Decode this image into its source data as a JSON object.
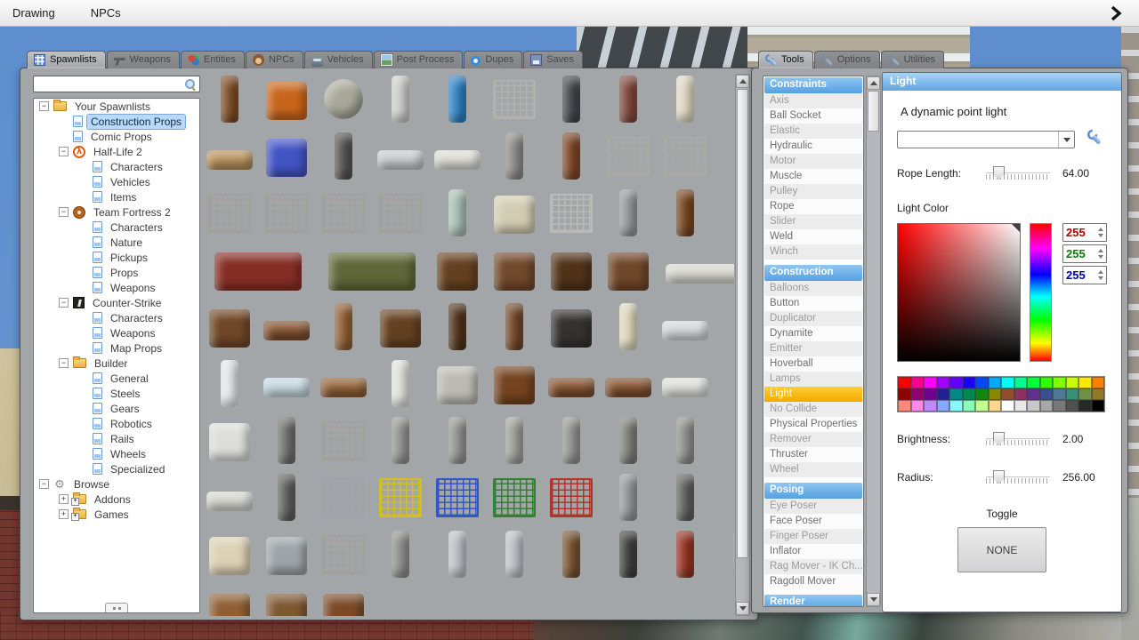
{
  "menubar": {
    "items": [
      "Drawing",
      "NPCs"
    ]
  },
  "spawnmenu": {
    "tabs": [
      {
        "id": "spawnlists",
        "label": "Spawnlists",
        "active": true
      },
      {
        "id": "weapons",
        "label": "Weapons"
      },
      {
        "id": "entities",
        "label": "Entities"
      },
      {
        "id": "npcs",
        "label": "NPCs"
      },
      {
        "id": "vehicles",
        "label": "Vehicles"
      },
      {
        "id": "postprocess",
        "label": "Post Process"
      },
      {
        "id": "dupes",
        "label": "Dupes"
      },
      {
        "id": "saves",
        "label": "Saves"
      }
    ],
    "search": {
      "value": "",
      "icon": "search-icon"
    },
    "tree": {
      "items": [
        {
          "d": 0,
          "e": "-",
          "i": "folder",
          "t": "Your Spawnlists"
        },
        {
          "d": 1,
          "i": "page",
          "t": "Construction Props",
          "sel": true
        },
        {
          "d": 1,
          "i": "page",
          "t": "Comic Props"
        },
        {
          "d": 1,
          "e": "-",
          "i": "hl2",
          "t": "Half-Life 2"
        },
        {
          "d": 2,
          "i": "page",
          "t": "Characters"
        },
        {
          "d": 2,
          "i": "page",
          "t": "Vehicles"
        },
        {
          "d": 2,
          "i": "page",
          "t": "Items"
        },
        {
          "d": 1,
          "e": "-",
          "i": "tf2",
          "t": "Team Fortress 2"
        },
        {
          "d": 2,
          "i": "page",
          "t": "Characters"
        },
        {
          "d": 2,
          "i": "page",
          "t": "Nature"
        },
        {
          "d": 2,
          "i": "page",
          "t": "Pickups"
        },
        {
          "d": 2,
          "i": "page",
          "t": "Props"
        },
        {
          "d": 2,
          "i": "page",
          "t": "Weapons"
        },
        {
          "d": 1,
          "e": "-",
          "i": "cs",
          "t": "Counter-Strike"
        },
        {
          "d": 2,
          "i": "page",
          "t": "Characters"
        },
        {
          "d": 2,
          "i": "page",
          "t": "Weapons"
        },
        {
          "d": 2,
          "i": "page",
          "t": "Map Props"
        },
        {
          "d": 1,
          "e": "-",
          "i": "folder",
          "t": "Builder"
        },
        {
          "d": 2,
          "i": "page",
          "t": "General"
        },
        {
          "d": 2,
          "i": "page",
          "t": "Steels"
        },
        {
          "d": 2,
          "i": "page",
          "t": "Gears"
        },
        {
          "d": 2,
          "i": "page",
          "t": "Robotics"
        },
        {
          "d": 2,
          "i": "page",
          "t": "Rails"
        },
        {
          "d": 2,
          "i": "page",
          "t": "Wheels"
        },
        {
          "d": 2,
          "i": "page",
          "t": "Specialized"
        },
        {
          "d": 0,
          "e": "-",
          "i": "gear",
          "t": "Browse"
        },
        {
          "d": 1,
          "e": "+",
          "i": "folder-add",
          "t": "Addons"
        },
        {
          "d": 1,
          "e": "+",
          "i": "folder-add",
          "t": "Games"
        }
      ]
    },
    "props": {
      "rows": [
        [
          {
            "n": "bar-stool",
            "c": "#7b4a26",
            "s": "tall"
          },
          {
            "n": "cable-spools",
            "c": "#c8651c",
            "s": "box"
          },
          {
            "n": "pulley-wheel",
            "c": "#a8a89a",
            "s": "round"
          },
          {
            "n": "metal-panel",
            "c": "#cdcdc8",
            "s": "tall"
          },
          {
            "n": "blue-barrel",
            "c": "#2e7fc2",
            "s": "tall"
          },
          {
            "n": "jail-bars",
            "c": "#b2b2ae",
            "s": "lattice"
          },
          {
            "n": "gas-canister-dark",
            "c": "#41464a",
            "s": "tall"
          },
          {
            "n": "gas-canister-red",
            "c": "#7e463c",
            "s": "tall"
          },
          {
            "n": "propane-tank",
            "c": "#ded8c2",
            "s": "tall"
          }
        ],
        [
          {
            "n": "wood-bench",
            "c": "#b5905a",
            "s": "flat"
          },
          {
            "n": "blue-chair",
            "c": "#4253c4",
            "s": "box"
          },
          {
            "n": "lamp-post",
            "c": "#54524e",
            "s": "tall"
          },
          {
            "n": "metal-sign",
            "c": "#c6c8ca",
            "s": "flat"
          },
          {
            "n": "white-shelf",
            "c": "#dcdcd4",
            "s": "flat"
          },
          {
            "n": "grey-door",
            "c": "#8d8b86",
            "s": "tall"
          },
          {
            "n": "wood-glass-door",
            "c": "#7b4526",
            "s": "tall"
          },
          {
            "n": "wire-fence",
            "c": "#aaaaa6",
            "s": "lattice"
          },
          {
            "n": "wire-fence-2",
            "c": "#aaaaa6",
            "s": "lattice"
          }
        ],
        [
          {
            "n": "wire-fence-3",
            "c": "#a0a09c",
            "s": "lattice"
          },
          {
            "n": "wire-fence-4",
            "c": "#a0a09c",
            "s": "lattice"
          },
          {
            "n": "wire-gate",
            "c": "#a0a09c",
            "s": "lattice"
          },
          {
            "n": "wire-fence-bent",
            "c": "#a0a09c",
            "s": "lattice"
          },
          {
            "n": "fountain",
            "c": "#a8c0b2",
            "s": "tall"
          },
          {
            "n": "bathtub",
            "c": "#d2cdb2",
            "s": "box"
          },
          {
            "n": "metal-bed-frame",
            "c": "#bcbcb8",
            "s": "lattice"
          },
          {
            "n": "water-heater",
            "c": "#93989a",
            "s": "tall"
          },
          {
            "n": "wood-chair",
            "c": "#74431f",
            "s": "tall"
          }
        ],
        [
          {
            "n": "sofa-red",
            "c": "#852e24",
            "s": "box",
            "w": 1
          },
          {
            "n": "sofa-green",
            "c": "#5f6738",
            "s": "box",
            "w": 1
          },
          {
            "n": "dresser",
            "c": "#64401f",
            "s": "box"
          },
          {
            "n": "chest-of-drawers",
            "c": "#71482a",
            "s": "box"
          },
          {
            "n": "dark-cabinet",
            "c": "#503218",
            "s": "box"
          },
          {
            "n": "drawers-2",
            "c": "#6f4628",
            "s": "box"
          },
          {
            "n": "mattress",
            "c": "#d6d6ce",
            "s": "flat",
            "w": 1
          },
          {
            "n": "mattress-2",
            "c": "#d6d6ce",
            "s": "flat",
            "w": 1
          }
        ],
        [
          {
            "n": "wood-shelf",
            "c": "#6f4626",
            "s": "box"
          },
          {
            "n": "coffee-table",
            "c": "#7e4e2c",
            "s": "flat"
          },
          {
            "n": "canoe",
            "c": "#8e5e34",
            "s": "tall"
          },
          {
            "n": "writing-desk",
            "c": "#63401f",
            "s": "box"
          },
          {
            "n": "small-cabinet",
            "c": "#4e3118",
            "s": "tall"
          },
          {
            "n": "tall-cabinet",
            "c": "#6f4626",
            "s": "tall"
          },
          {
            "n": "wood-stove",
            "c": "#33322f",
            "s": "box"
          },
          {
            "n": "old-fridge",
            "c": "#ddd8bc",
            "s": "tall"
          },
          {
            "n": "radiator",
            "c": "#d3d6d8",
            "s": "flat"
          }
        ],
        [
          {
            "n": "freezer",
            "c": "#e4e6e8",
            "s": "tall"
          },
          {
            "n": "glass-pane",
            "c": "#c2d6de",
            "s": "flat"
          },
          {
            "n": "clothes-rack",
            "c": "#8e5e34",
            "s": "flat"
          },
          {
            "n": "sink",
            "c": "#e2e2dc",
            "s": "tall"
          },
          {
            "n": "metal-cabinet",
            "c": "#bcbcb4",
            "s": "box"
          },
          {
            "n": "round-table",
            "c": "#74431f",
            "s": "box"
          },
          {
            "n": "wood-table",
            "c": "#7e4e2c",
            "s": "flat"
          },
          {
            "n": "wood-table-2",
            "c": "#7e4e2c",
            "s": "flat"
          },
          {
            "n": "small-frame",
            "c": "#dcdcd8",
            "s": "flat"
          }
        ],
        [
          {
            "n": "washer",
            "c": "#dddeda",
            "s": "box"
          },
          {
            "n": "street-lamp",
            "c": "#6e6e6a",
            "s": "tall"
          },
          {
            "n": "metal-gate",
            "c": "#a0a09c",
            "s": "lattice"
          },
          {
            "n": "gravestone-1",
            "c": "#93938e",
            "s": "tall"
          },
          {
            "n": "gravestone-2",
            "c": "#93938e",
            "s": "tall"
          },
          {
            "n": "gravestone-3",
            "c": "#9e9e98",
            "s": "tall"
          },
          {
            "n": "gravestone-4",
            "c": "#93938e",
            "s": "tall"
          },
          {
            "n": "stone-monument",
            "c": "#7e7e78",
            "s": "tall"
          },
          {
            "n": "thin-pole",
            "c": "#8e8e8a",
            "s": "tall"
          }
        ],
        [
          {
            "n": "white-shelf-2",
            "c": "#d4d4ce",
            "s": "flat"
          },
          {
            "n": "hydrant-pole",
            "c": "#5e5e5a",
            "s": "tall"
          },
          {
            "n": "cage-grey",
            "c": "#9ea4aa",
            "s": "lattice"
          },
          {
            "n": "cage-yellow",
            "c": "#d6c020",
            "s": "lattice"
          },
          {
            "n": "cage-blue",
            "c": "#2e52c2",
            "s": "lattice"
          },
          {
            "n": "cage-green",
            "c": "#2e7e2e",
            "s": "lattice"
          },
          {
            "n": "cage-red",
            "c": "#b22e24",
            "s": "lattice"
          },
          {
            "n": "stone-pillar",
            "c": "#93969a",
            "s": "tall"
          },
          {
            "n": "hand-truck",
            "c": "#5e5e5c",
            "s": "tall"
          }
        ],
        [
          {
            "n": "lampshade",
            "c": "#dcd1b4",
            "s": "box"
          },
          {
            "n": "lockers",
            "c": "#9ea4a8",
            "s": "box"
          },
          {
            "n": "ladder",
            "c": "#a0a09c",
            "s": "lattice"
          },
          {
            "n": "thin-rod",
            "c": "#8e8e8a",
            "s": "tall"
          },
          {
            "n": "faucet-pipe",
            "c": "#bcc0c4",
            "s": "tall"
          },
          {
            "n": "faucet-pipe-2",
            "c": "#bcc0c4",
            "s": "tall"
          },
          {
            "n": "rust-barrel",
            "c": "#74502e",
            "s": "tall"
          },
          {
            "n": "dark-barrel",
            "c": "#3e3e3c",
            "s": "tall"
          },
          {
            "n": "red-barrel",
            "c": "#93301f",
            "s": "tall"
          },
          {
            "n": "sign-pole",
            "c": "#8e8e8a",
            "s": "tall"
          }
        ],
        [
          {
            "n": "pallet",
            "c": "#8e5e34",
            "s": "box"
          },
          {
            "n": "crate-2",
            "c": "#7e5733",
            "s": "box"
          },
          {
            "n": "table-3",
            "c": "#7a4a28",
            "s": "box"
          }
        ]
      ]
    }
  },
  "tools": {
    "tabs": [
      {
        "id": "tools",
        "label": "Tools",
        "active": true
      },
      {
        "id": "options",
        "label": "Options"
      },
      {
        "id": "utilities",
        "label": "Utilities"
      }
    ],
    "categories": [
      {
        "label": "Constraints",
        "items": [
          {
            "t": "Axis"
          },
          {
            "t": "Ball Socket"
          },
          {
            "t": "Elastic"
          },
          {
            "t": "Hydraulic"
          },
          {
            "t": "Motor"
          },
          {
            "t": "Muscle"
          },
          {
            "t": "Pulley"
          },
          {
            "t": "Rope"
          },
          {
            "t": "Slider"
          },
          {
            "t": "Weld"
          },
          {
            "t": "Winch"
          }
        ]
      },
      {
        "label": "Construction",
        "items": [
          {
            "t": "Balloons"
          },
          {
            "t": "Button"
          },
          {
            "t": "Duplicator"
          },
          {
            "t": "Dynamite"
          },
          {
            "t": "Emitter"
          },
          {
            "t": "Hoverball"
          },
          {
            "t": "Lamps"
          },
          {
            "t": "Light",
            "sel": true
          },
          {
            "t": "No Collide"
          },
          {
            "t": "Physical Properties"
          },
          {
            "t": "Remover"
          },
          {
            "t": "Thruster"
          },
          {
            "t": "Wheel"
          }
        ]
      },
      {
        "label": "Posing",
        "items": [
          {
            "t": "Eye Poser"
          },
          {
            "t": "Face Poser"
          },
          {
            "t": "Finger Poser"
          },
          {
            "t": "Inflator"
          },
          {
            "t": "Rag Mover - IK Ch..."
          },
          {
            "t": "Ragdoll Mover"
          }
        ]
      },
      {
        "label": "Render",
        "items": []
      }
    ]
  },
  "light": {
    "title": "Light",
    "description": "A dynamic point light",
    "preset_value": "",
    "rope": {
      "label": "Rope Length:",
      "value": "64.00"
    },
    "color_label": "Light Color",
    "rgb": [
      {
        "channel": "r",
        "value": "255"
      },
      {
        "channel": "g",
        "value": "255"
      },
      {
        "channel": "b",
        "value": "255"
      }
    ],
    "palette": [
      [
        "#ff0000",
        "#ff0090",
        "#ff00ff",
        "#a000ff",
        "#6000ff",
        "#1800ff",
        "#0048ff",
        "#00a8ff",
        "#00fff0",
        "#00ff90",
        "#00ff38",
        "#30ff00",
        "#80ff00",
        "#c8ff00",
        "#ffe800",
        "#ff8000"
      ],
      [
        "#900000",
        "#900070",
        "#700090",
        "#202090",
        "#008888",
        "#008850",
        "#108810",
        "#888800",
        "#905030",
        "#903060",
        "#603090",
        "#385090",
        "#507898",
        "#389078",
        "#709048",
        "#907828"
      ],
      [
        "#ff8878",
        "#ff88e8",
        "#c088ff",
        "#88a8ff",
        "#88f8ff",
        "#88ffb8",
        "#c0ff90",
        "#ffd890",
        "#ffffff",
        "#e8e8e8",
        "#c8c8c8",
        "#a8a8a8",
        "#787878",
        "#505050",
        "#282828",
        "#000000"
      ]
    ],
    "brightness": {
      "label": "Brightness:",
      "value": "2.00"
    },
    "radius": {
      "label": "Radius:",
      "value": "256.00"
    },
    "toggle_label": "Toggle",
    "toggle_button": "NONE"
  }
}
